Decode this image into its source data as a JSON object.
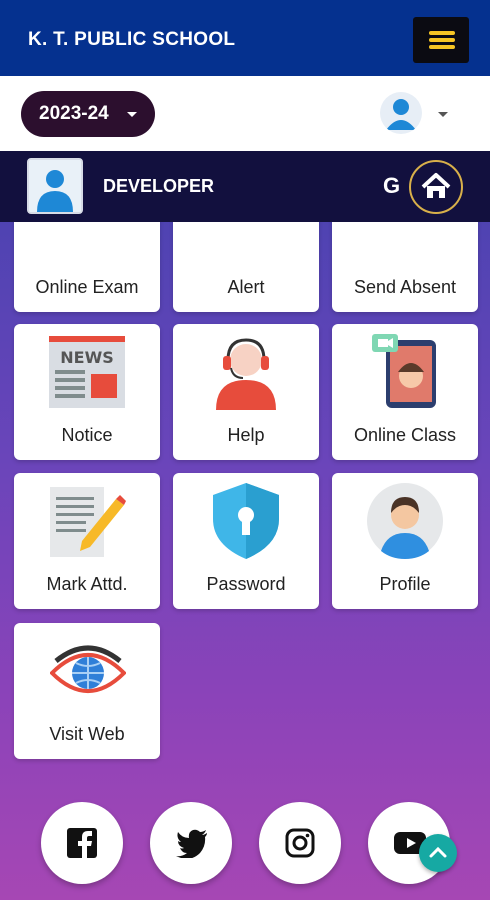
{
  "app": {
    "title": "K. T. PUBLIC SCHOOL"
  },
  "toolbar": {
    "year": "2023-24"
  },
  "user": {
    "name": "DEVELOPER",
    "g_label": "G"
  },
  "tiles": [
    {
      "label": "Online Exam",
      "icon": "online-exam-icon"
    },
    {
      "label": "Alert",
      "icon": "bell-icon"
    },
    {
      "label": "Send Absent",
      "icon": "send-absent-icon"
    },
    {
      "label": "Notice",
      "icon": "news-icon"
    },
    {
      "label": "Help",
      "icon": "headset-icon"
    },
    {
      "label": "Online Class",
      "icon": "video-class-icon"
    },
    {
      "label": "Mark Attd.",
      "icon": "document-pencil-icon"
    },
    {
      "label": "Password",
      "icon": "shield-key-icon"
    },
    {
      "label": "Profile",
      "icon": "profile-avatar-icon"
    },
    {
      "label": "Visit Web",
      "icon": "eye-globe-icon"
    }
  ],
  "social": [
    "facebook-icon",
    "twitter-icon",
    "instagram-icon",
    "youtube-icon"
  ],
  "colors": {
    "appbar": "#05318f",
    "devbar": "#12103e",
    "year_pill": "#2c0f2e",
    "menu_bar": "#f6c524",
    "scroll_top": "#16a9a3"
  }
}
